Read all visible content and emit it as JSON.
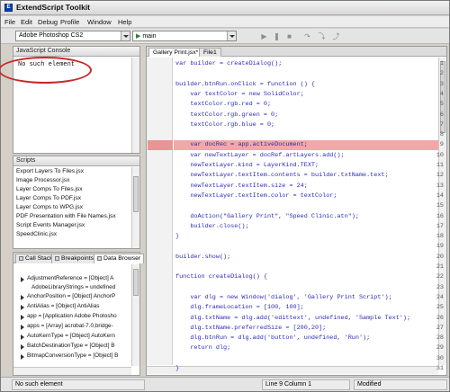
{
  "app": {
    "title": "ExtendScript Toolkit"
  },
  "menu": [
    "File",
    "Edit",
    "Debug",
    "Profile",
    "Window",
    "Help"
  ],
  "toolbar": {
    "target_app": "Adobe Photoshop CS2",
    "engine": "main"
  },
  "console": {
    "title": "JavaScript Console",
    "output": "No such element"
  },
  "scripts": {
    "title": "Scripts",
    "items": [
      "Export Layers To Files.jsx",
      "Image Processor.jsx",
      "Layer Comps To Files.jsx",
      "Layer Comps To PDF.jsx",
      "Layer Comps to WPG.jsx",
      "PDF Presentation with File Names.jsx",
      "Script Events Manager.jsx",
      "SpeedClinic.jsx"
    ]
  },
  "data_panel": {
    "tabs": [
      "Call Stack",
      "Breakpoints",
      "Data Browser"
    ],
    "items": [
      "AdjustmentReference = [Object] A",
      "AdobeLibraryStrings = undefined",
      "AnchorPosition = [Object] AnchorP",
      "AntiAlias = [Object] AntiAlias",
      "app = [Application Adobe Photosho",
      "apps = [Array] acrobat-7.0,bridge-",
      "AutoKernType = [Object] AutoKern",
      "BatchDestinationType = [Object] B",
      "BitmapConversionType = [Object] B"
    ]
  },
  "editor": {
    "tabs": [
      "Gallery Print.jsx*",
      "File1"
    ],
    "highlight_line": 9,
    "lines": [
      {
        "n": "1",
        "code": "var builder = createDialog();"
      },
      {
        "n": "2",
        "code": ""
      },
      {
        "n": "3",
        "code": "builder.btnRun.onClick = function () {"
      },
      {
        "n": "4",
        "code": "    var textColor = new SolidColor;"
      },
      {
        "n": "5",
        "code": "    textColor.rgb.red = 0;"
      },
      {
        "n": "6",
        "code": "    textColor.rgb.green = 0;"
      },
      {
        "n": "7",
        "code": "    textColor.rgb.blue = 0;"
      },
      {
        "n": "8",
        "code": ""
      },
      {
        "n": "9",
        "code": "    var docRec = app.activeDocument;"
      },
      {
        "n": "10",
        "code": "    var newTextLayer = docRef.artLayers.add();"
      },
      {
        "n": "11",
        "code": "    newTextLayer.kind = LayerKind.TEXT;"
      },
      {
        "n": "12",
        "code": "    newTextLayer.textItem.contents = builder.txtName.text;"
      },
      {
        "n": "13",
        "code": "    newTextLayer.textItem.size = 24;"
      },
      {
        "n": "14",
        "code": "    newTextLayer.textItem.color = textColor;"
      },
      {
        "n": "15",
        "code": ""
      },
      {
        "n": "16",
        "code": "    doAction(\"Gallery Print\", \"Speed Clinic.atn\");"
      },
      {
        "n": "17",
        "code": "    builder.close();"
      },
      {
        "n": "18",
        "code": "}"
      },
      {
        "n": "19",
        "code": ""
      },
      {
        "n": "20",
        "code": "builder.show();"
      },
      {
        "n": "21",
        "code": ""
      },
      {
        "n": "22",
        "code": "function createDialog() {"
      },
      {
        "n": "23",
        "code": ""
      },
      {
        "n": "24",
        "code": "    var dlg = new Window('dialog', 'Gallery Print Script');"
      },
      {
        "n": "25",
        "code": "    dlg.frameLocation = [100, 100];"
      },
      {
        "n": "26",
        "code": "    dlg.txtName = dlg.add('edittext', undefined, 'Sample Text');"
      },
      {
        "n": "27",
        "code": "    dlg.txtName.preferredSize = [200,20];"
      },
      {
        "n": "28",
        "code": "    dlg.btnRun = dlg.add('button', undefined, 'Run');"
      },
      {
        "n": "29",
        "code": "    return dlg;"
      },
      {
        "n": "30",
        "code": ""
      },
      {
        "n": "31",
        "code": "}"
      }
    ]
  },
  "status": {
    "message": "No such element",
    "position": "Line 9 Column 1",
    "state": "Modified"
  },
  "colors": {
    "highlight_row": "#f2a8a8",
    "code_text": "#2a2ab8",
    "annotation_oval": "#c62828"
  }
}
